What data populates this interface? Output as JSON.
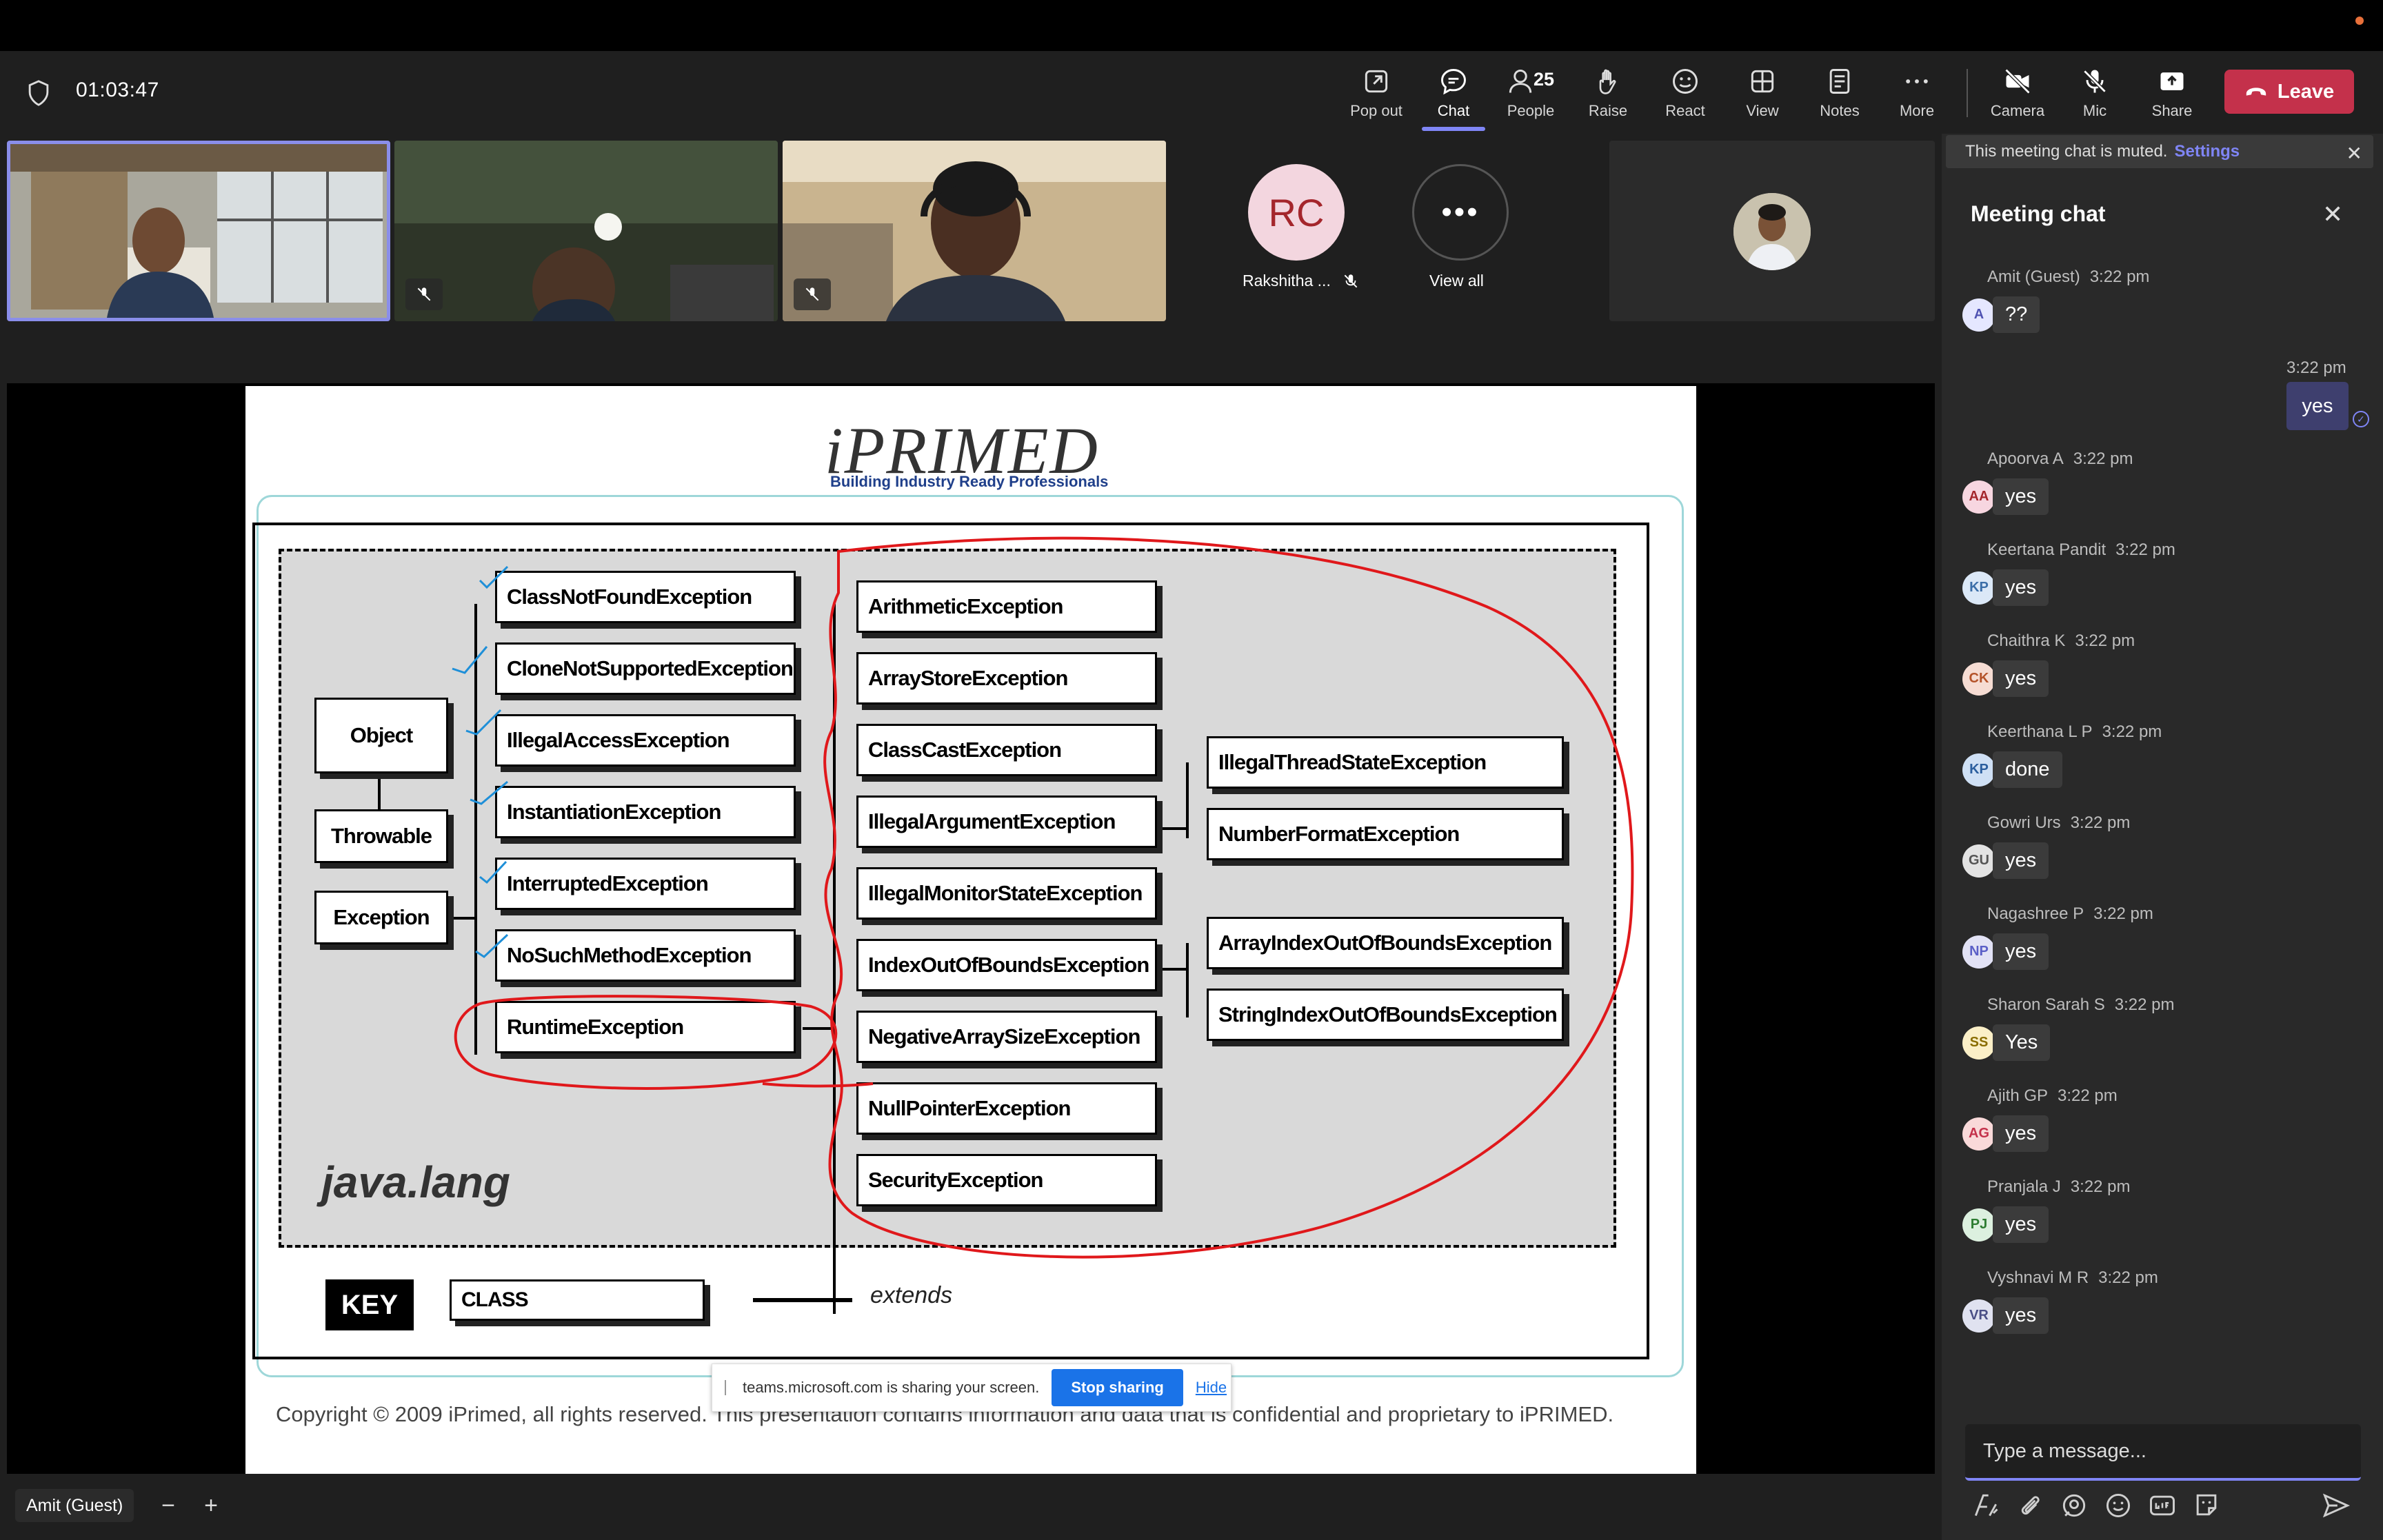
{
  "meeting": {
    "timer": "01:03:47"
  },
  "toolbar": {
    "popout": "Pop out",
    "chat": "Chat",
    "people": "People",
    "people_count": "25",
    "raise": "Raise",
    "react": "React",
    "view": "View",
    "notes": "Notes",
    "more": "More",
    "camera": "Camera",
    "mic": "Mic",
    "share": "Share",
    "leave": "Leave"
  },
  "participants": {
    "rc_initials": "RC",
    "rc_name": "Rakshitha ...",
    "view_all": "View all"
  },
  "presenter": {
    "name": "Amit (Guest)"
  },
  "slide": {
    "logo": "iPRIMED",
    "tagline": "Building Industry Ready Professionals",
    "left_col": [
      "Object",
      "Throwable",
      "Exception"
    ],
    "mid_col": [
      "ClassNotFoundException",
      "CloneNotSupportedException",
      "IllegalAccessException",
      "InstantiationException",
      "InterruptedException",
      "NoSuchMethodException",
      "RuntimeException"
    ],
    "runtime_col": [
      "ArithmeticException",
      "ArrayStoreException",
      "ClassCastException",
      "IllegalArgumentException",
      "IllegalMonitorStateException",
      "IndexOutOfBoundsException",
      "NegativeArraySizeException",
      "NullPointerException",
      "SecurityException"
    ],
    "right_col": [
      "IllegalThreadStateException",
      "NumberFormatException",
      "ArrayIndexOutOfBoundsException",
      "StringIndexOutOfBoundsException"
    ],
    "package": "java.lang",
    "key": "KEY",
    "key_class": "CLASS",
    "key_extends": "extends",
    "copyright": "Copyright © 2009 iPrimed, all rights reserved. This presentation contains information  and data  that is confidential and proprietary to iPRIMED."
  },
  "share_banner": {
    "text": "teams.microsoft.com is sharing your screen.",
    "stop": "Stop sharing",
    "hide": "Hide"
  },
  "chat": {
    "muted_notice": "This meeting chat is muted.",
    "settings": "Settings",
    "title": "Meeting chat",
    "my_time": "3:22 pm",
    "my_text": "yes",
    "composer_placeholder": "Type a message...",
    "messages": [
      {
        "name": "Amit (Guest)",
        "time": "3:22 pm",
        "initials": "A",
        "text": "??",
        "bg": "#e5e7ff",
        "fg": "#4f52b2"
      },
      {
        "name": "Apoorva A",
        "time": "3:22 pm",
        "initials": "AA",
        "text": "yes",
        "bg": "#f7d6e0",
        "fg": "#a4262c"
      },
      {
        "name": "Keertana Pandit",
        "time": "3:22 pm",
        "initials": "KP",
        "text": "yes",
        "bg": "#dbe8f7",
        "fg": "#3b6ea8"
      },
      {
        "name": "Chaithra K",
        "time": "3:22 pm",
        "initials": "CK",
        "text": "yes",
        "bg": "#f6dcd3",
        "fg": "#b4532a"
      },
      {
        "name": "Keerthana L P",
        "time": "3:22 pm",
        "initials": "KP",
        "text": "done",
        "bg": "#cfe0f5",
        "fg": "#2b5e9e"
      },
      {
        "name": "Gowri Urs",
        "time": "3:22 pm",
        "initials": "GU",
        "text": "yes",
        "bg": "#e3e3e3",
        "fg": "#555555"
      },
      {
        "name": "Nagashree P",
        "time": "3:22 pm",
        "initials": "NP",
        "text": "yes",
        "bg": "#e2e2f5",
        "fg": "#5b5fc7"
      },
      {
        "name": "Sharon Sarah S",
        "time": "3:22 pm",
        "initials": "SS",
        "text": "Yes",
        "bg": "#fbefc7",
        "fg": "#8a6d00"
      },
      {
        "name": "Ajith GP",
        "time": "3:22 pm",
        "initials": "AG",
        "text": "yes",
        "bg": "#f9d9d9",
        "fg": "#c4314b"
      },
      {
        "name": "Pranjala J",
        "time": "3:22 pm",
        "initials": "PJ",
        "text": "yes",
        "bg": "#dcf0df",
        "fg": "#2e7d32"
      },
      {
        "name": "Vyshnavi M R",
        "time": "3:22 pm",
        "initials": "VR",
        "text": "yes",
        "bg": "#e0e2f0",
        "fg": "#4a4f86"
      }
    ]
  },
  "colors": {
    "accent": "#7f85f5",
    "leave": "#c4314b",
    "stop_sharing": "#1a73e8",
    "annotation": "#e0181b"
  }
}
